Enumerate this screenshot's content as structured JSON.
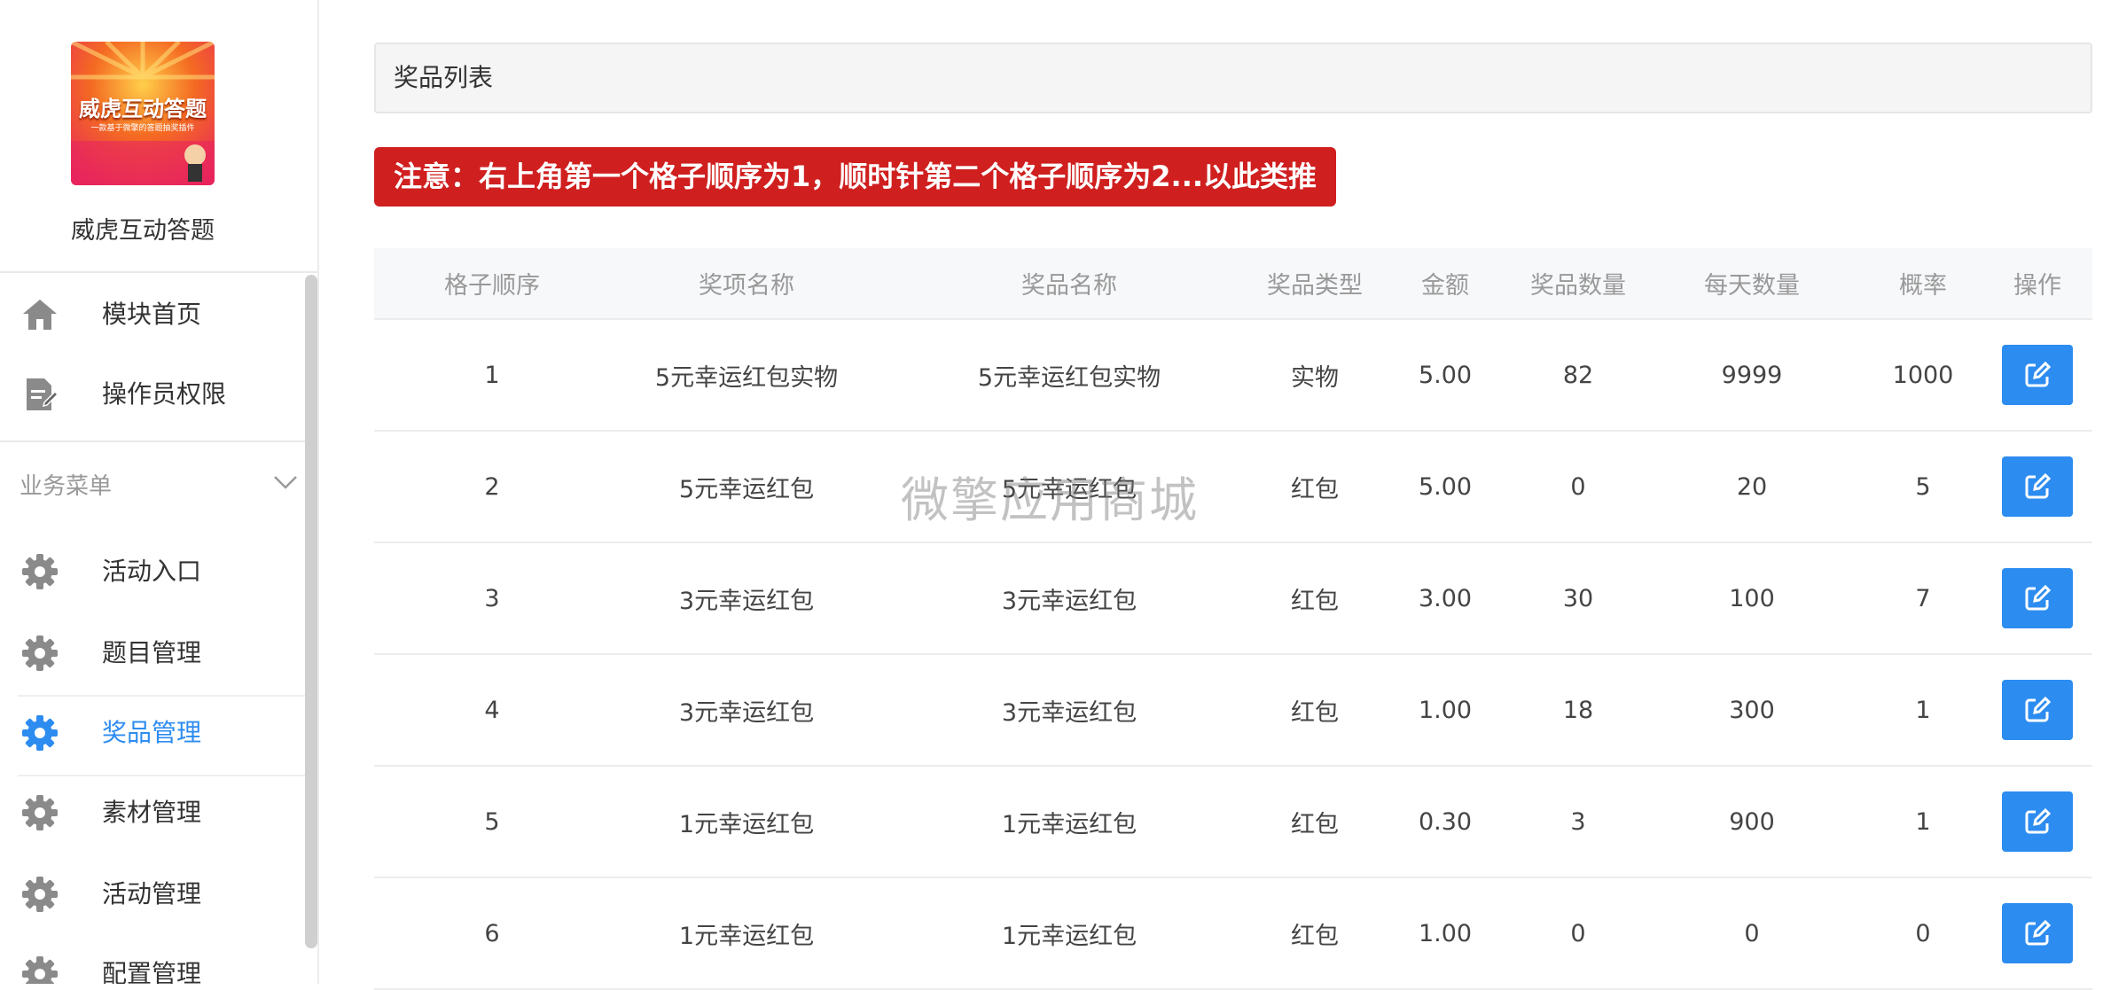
{
  "sidebar": {
    "brand_name": "威虎互动答题",
    "logo_text": "威虎互动答题",
    "logo_subtext": "一款基于微擎的答题抽奖插件",
    "top_items": [
      {
        "label": "模块首页",
        "icon": "home-icon"
      },
      {
        "label": "操作员权限",
        "icon": "document-edit-icon"
      }
    ],
    "section_title": "业务菜单",
    "items": [
      {
        "label": "活动入口",
        "icon": "gear-icon"
      },
      {
        "label": "题目管理",
        "icon": "gear-icon"
      },
      {
        "label": "奖品管理",
        "icon": "gear-icon",
        "active": true
      },
      {
        "label": "素材管理",
        "icon": "gear-icon"
      },
      {
        "label": "活动管理",
        "icon": "gear-icon"
      },
      {
        "label": "配置管理",
        "icon": "gear-icon"
      }
    ]
  },
  "main": {
    "panel_title": "奖品列表",
    "notice": "注意：右上角第一个格子顺序为1，顺时针第二个格子顺序为2...以此类推",
    "columns": [
      "格子顺序",
      "奖项名称",
      "奖品名称",
      "奖品类型",
      "金额",
      "奖品数量",
      "每天数量",
      "概率",
      "操作"
    ],
    "rows": [
      [
        "1",
        "5元幸运红包实物",
        "5元幸运红包实物",
        "实物",
        "5.00",
        "82",
        "9999",
        "1000"
      ],
      [
        "2",
        "5元幸运红包",
        "5元幸运红包",
        "红包",
        "5.00",
        "0",
        "20",
        "5"
      ],
      [
        "3",
        "3元幸运红包",
        "3元幸运红包",
        "红包",
        "3.00",
        "30",
        "100",
        "7"
      ],
      [
        "4",
        "3元幸运红包",
        "3元幸运红包",
        "红包",
        "1.00",
        "18",
        "300",
        "1"
      ],
      [
        "5",
        "1元幸运红包",
        "1元幸运红包",
        "红包",
        "0.30",
        "3",
        "900",
        "1"
      ],
      [
        "6",
        "1元幸运红包",
        "1元幸运红包",
        "红包",
        "1.00",
        "0",
        "0",
        "0"
      ]
    ]
  },
  "watermark": "微擎应用商城",
  "colors": {
    "accent": "#2d8cf0",
    "notice_bg": "#d01f1f",
    "icon_gray": "#8a8a8a"
  }
}
